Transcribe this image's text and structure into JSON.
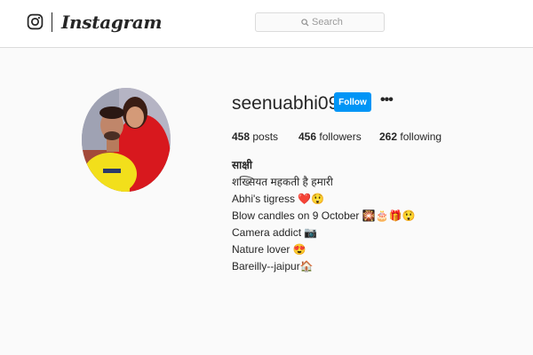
{
  "app": {
    "wordmark": "Instagram"
  },
  "search": {
    "placeholder": "Search"
  },
  "profile": {
    "username": "seenuabhi09",
    "follow_label": "Follow",
    "more_label": "•••",
    "stats": {
      "posts_count": "458",
      "posts_label": "posts",
      "followers_count": "456",
      "followers_label": "followers",
      "following_count": "262",
      "following_label": "following"
    },
    "bio": {
      "name": "साक्षी",
      "lines": [
        "शख्सियत महकती है हमारी",
        "Abhi's tigress ❤️😲",
        "Blow candles on 9 October 🎇🎂🎁😲",
        "Camera addict 📷",
        "Nature lover 😍",
        "Bareilly--jaipur🏠"
      ]
    }
  },
  "colors": {
    "accent": "#0095f6",
    "background": "#fafafa",
    "text": "#262626",
    "border": "#dbdbdb"
  },
  "icons": {
    "logo": "instagram-glyph-icon",
    "search": "search-icon",
    "more": "more-options-icon"
  }
}
